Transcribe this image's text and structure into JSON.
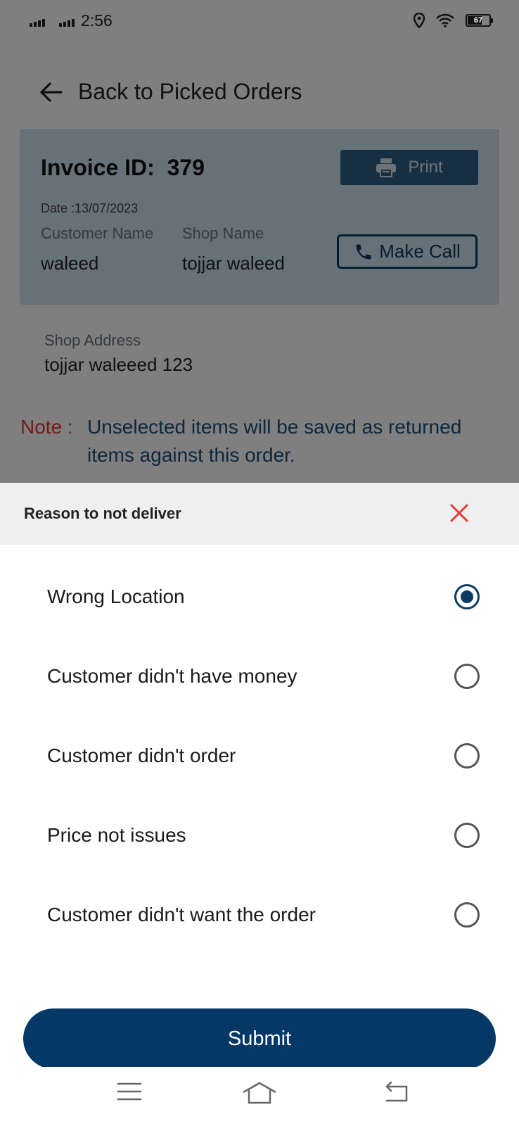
{
  "status_bar": {
    "time": "2:56",
    "battery": "67"
  },
  "header": {
    "back_label": "Back to Picked Orders"
  },
  "invoice": {
    "title": "Invoice ID:  379",
    "date": "Date :13/07/2023",
    "print_label": "Print",
    "customer_name_label": "Customer Name",
    "customer_name": "waleed",
    "shop_name_label": "Shop Name",
    "shop_name": "tojjar waleed",
    "call_label": "Make Call",
    "address_label": "Shop Address",
    "address": "tojjar waleeed 123"
  },
  "note": {
    "label": "Note :",
    "text": "Unselected items will be saved as returned items against this order."
  },
  "sheet": {
    "title": "Reason to not deliver",
    "options": [
      {
        "label": "Wrong Location",
        "selected": true
      },
      {
        "label": "Customer didn't have money",
        "selected": false
      },
      {
        "label": "Customer didn't order",
        "selected": false
      },
      {
        "label": "Price not issues",
        "selected": false
      },
      {
        "label": "Customer didn't want the order",
        "selected": false
      }
    ],
    "submit_label": "Submit"
  },
  "colors": {
    "primary": "#053866",
    "note_label": "#e53935",
    "close_icon": "#e53935"
  }
}
